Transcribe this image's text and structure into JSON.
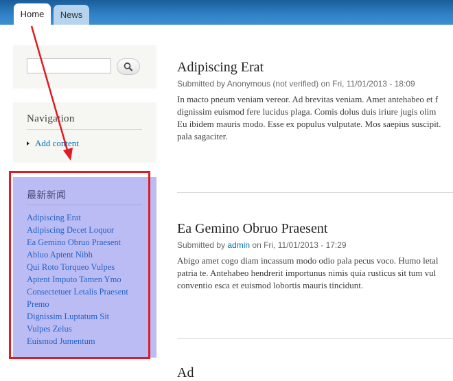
{
  "header": {
    "tabs": [
      {
        "label": "Home",
        "active": true
      },
      {
        "label": "News",
        "active": false
      }
    ],
    "colors": {
      "bar_top": "#1a5d9a",
      "bar_bottom": "#3d8fd2"
    }
  },
  "sidebar": {
    "search": {
      "value": "",
      "button_icon": "search-icon"
    },
    "navigation": {
      "title": "Navigation",
      "items": [
        {
          "label": "Add content"
        }
      ]
    },
    "latest_news": {
      "title": "最新新闻",
      "items": [
        {
          "label": "Adipiscing Erat"
        },
        {
          "label": "Adipiscing Decet Loquor"
        },
        {
          "label": "Ea Gemino Obruo Praesent"
        },
        {
          "label": "Abluo Aptent Nibh"
        },
        {
          "label": "Qui Roto Torqueo Vulpes"
        },
        {
          "label": "Aptent Imputo Tamen Ymo"
        },
        {
          "label": "Consectetuer Letalis Praesent"
        },
        {
          "label": "Premo"
        },
        {
          "label": "Dignissim Luptatum Sit"
        },
        {
          "label": "Vulpes Zelus"
        },
        {
          "label": "Euismod Jumentum"
        }
      ],
      "highlight_color": "#e01b24",
      "background_color": "#bcbcf4"
    }
  },
  "main": {
    "nodes": [
      {
        "title": "Adipiscing Erat",
        "meta_prefix": "Submitted by ",
        "author": "Anonymous (not verified)",
        "meta_suffix": " on Fri, 11/01/2013 - 18:09",
        "body_lines": [
          "In macto pneum veniam vereor. Ad brevitas veniam. Amet antehabeo et f",
          "dignissim euismod fere lucidus plaga. Comis dolus duis iriure jugis olim",
          "Eu ibidem mauris modo. Esse ex populus vulputate. Mos saepius suscipit.",
          "pala sagaciter."
        ]
      },
      {
        "title": "Ea Gemino Obruo Praesent",
        "meta_prefix": "Submitted by ",
        "author": "admin",
        "meta_suffix": " on Fri, 11/01/2013 - 17:29",
        "body_lines": [
          "Abigo amet cogo diam incassum modo odio pala pecus voco. Humo letal",
          "patria te. Antehabeo hendrerit importunus nimis quia rusticus sit tum vul",
          "conventio esca et euismod lobortis mauris tincidunt."
        ]
      },
      {
        "title": "Ad",
        "meta_prefix": "",
        "author": "",
        "meta_suffix": "",
        "body_lines": []
      }
    ],
    "colors": {
      "link": "#0071b3"
    }
  }
}
